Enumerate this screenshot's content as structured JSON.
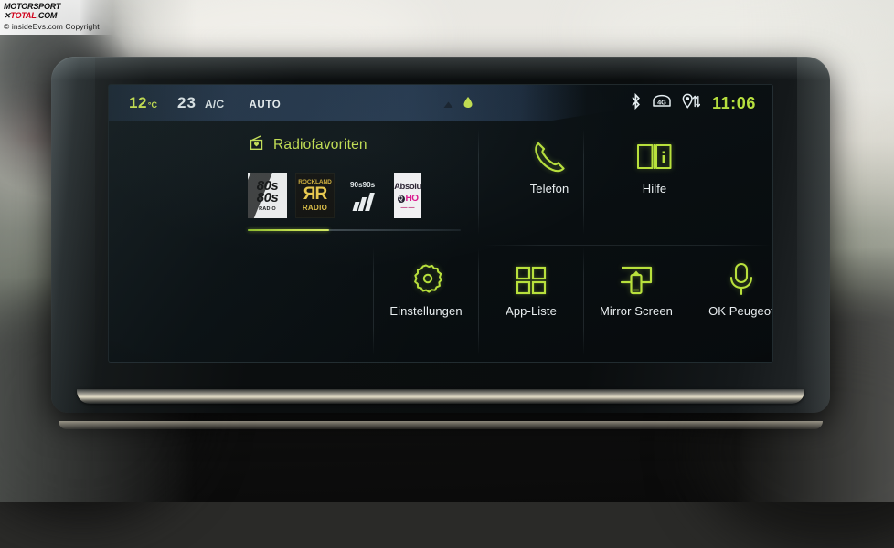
{
  "watermark": {
    "brand_line1": "MOTORSPORT",
    "brand_x": "✕",
    "brand_total": "TOTAL",
    "brand_dotcom": ".COM",
    "credit": "© insideEvs.com Copyright"
  },
  "status_bar": {
    "outside_temp": "12",
    "outside_unit": "°C",
    "cabin_temp": "23",
    "ac_label": "A/C",
    "auto_label": "AUTO",
    "center_icons": [
      "chevron-up-icon",
      "drop-indicator-icon"
    ],
    "right_icons": [
      "bluetooth-icon",
      "signal-4g-icon",
      "location-sync-icon"
    ],
    "clock": "11:06",
    "colors": {
      "accent_green": "#c6e04a",
      "clock_green": "#b6de3e",
      "text_white": "#dfe6e8"
    }
  },
  "radio_widget": {
    "icon": "radio-favorites-icon",
    "title": "Radiofavoriten",
    "stations": [
      {
        "name": "80s80s RADIO",
        "line1": "80s",
        "line2": "80s",
        "line3": "RADIO",
        "style": "white"
      },
      {
        "name": "Rockland Radio",
        "line1": "ROCKLAND",
        "line2": "ЯR",
        "line3": "RADIO",
        "style": "black-gold"
      },
      {
        "name": "90s90s",
        "line1": "90s90s",
        "line2": "",
        "line3": "",
        "style": "bars"
      },
      {
        "name": "Absolut HOT",
        "line1": "Absolu",
        "line2": "HO",
        "line3": "",
        "style": "white-pink"
      }
    ],
    "scroll_percent": 38
  },
  "tiles": [
    {
      "id": "telefon",
      "label": "Telefon",
      "icon": "phone-handset-icon"
    },
    {
      "id": "hilfe",
      "label": "Hilfe",
      "icon": "help-book-icon"
    },
    {
      "id": "einstellungen",
      "label": "Einstellungen",
      "icon": "gear-icon"
    },
    {
      "id": "app-liste",
      "label": "App-Liste",
      "icon": "grid-apps-icon"
    },
    {
      "id": "mirror-screen",
      "label": "Mirror Screen",
      "icon": "screen-mirror-icon"
    },
    {
      "id": "ok-peugeot",
      "label": "OK Peugeot",
      "icon": "microphone-icon"
    }
  ],
  "theme": {
    "icon_green": "#b8e03c",
    "lcd_background": "#0a1013",
    "bezel": "#0b0e0f"
  }
}
